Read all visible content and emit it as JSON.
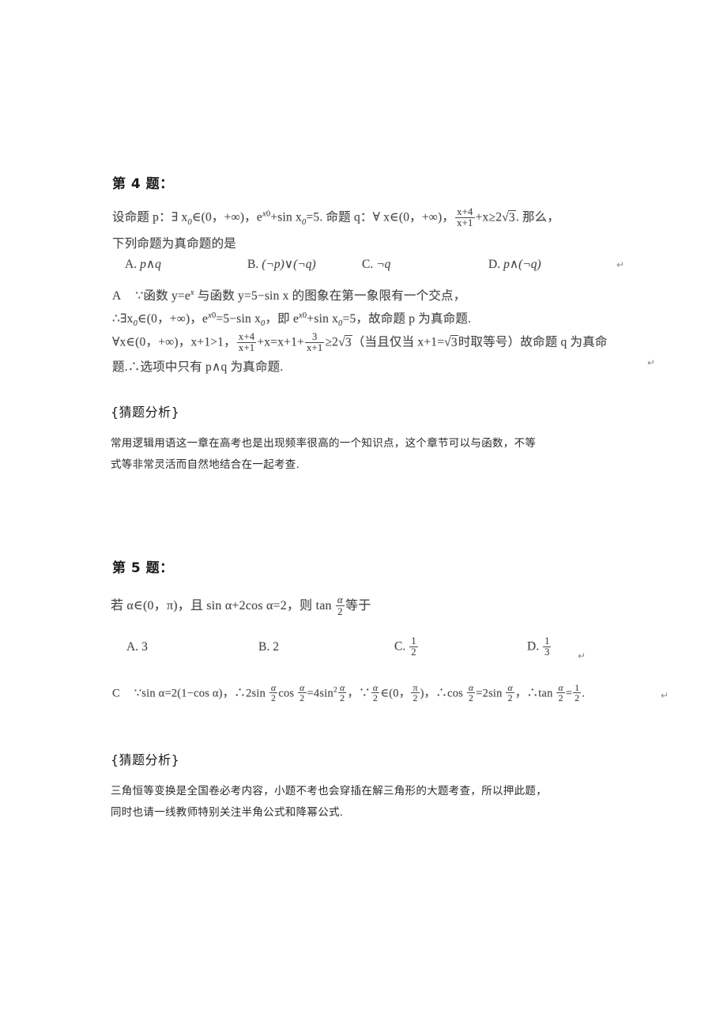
{
  "document": {
    "background_color": "#ffffff",
    "text_color": "#231f20"
  },
  "problems": [
    {
      "id": "q4",
      "heading": "第 4 题：",
      "statement_line1_prefix": "设命题 p：∃ x",
      "statement_line1_a": "∈(0，+∞)，e",
      "statement_line1_b": "+sin x",
      "statement_line1_c": "=5. 命题 q：∀ x∈(0，+∞)，",
      "statement_fraction_num": "x+4",
      "statement_fraction_den": "x+1",
      "statement_line1_d": "+x≥2",
      "statement_radicand": "3",
      "statement_line1_e": ". 那么，",
      "statement_line2": "下列命题为真命题的是",
      "options": [
        {
          "letter": "A.",
          "text": "p∧q"
        },
        {
          "letter": "B.",
          "text": "(¬p)∨(¬q)"
        },
        {
          "letter": "C.",
          "text": "¬q"
        },
        {
          "letter": "D.",
          "text": "p∧(¬q)"
        }
      ],
      "answer_letter": "A",
      "solution_line1": "∵函数 y=e",
      "solution_line1_b": " 与函数 y=5−sin x 的图象在第一象限有一个交点，",
      "solution_line2_a": "∴∃x",
      "solution_line2_b": "∈(0，+∞)，e",
      "solution_line2_c": "=5−sin x",
      "solution_line2_d": "，即 e",
      "solution_line2_e": "+sin x",
      "solution_line2_f": "=5，故命题 p 为真命题.",
      "solution_line3_a": "∀x∈(0，+∞)，x+1>1，",
      "solution_line3_b": "+x=x+1+",
      "solution_line3_frac2_num": "3",
      "solution_line3_frac2_den": "x+1",
      "solution_line3_c": "≥2",
      "solution_line3_d": "（当且仅当 x+1=",
      "solution_line3_e": "时取等号）故命题 q 为真命",
      "solution_line4": "题.∴选项中只有 p∧q 为真命题.",
      "analysis_heading": "{猜题分析}",
      "analysis_line1": "常用逻辑用语这一章在高考也是出现频率很高的一个知识点，这个章节可以与函数，不等",
      "analysis_line2": "式等非常灵活而自然地结合在一起考查."
    },
    {
      "id": "q5",
      "heading": "第 5 题：",
      "statement_a": "若 α∈(0，π)，且 sin α+2cos α=2，则 tan ",
      "statement_frac_num": "α",
      "statement_frac_den": "2",
      "statement_b": "等于",
      "options": [
        {
          "letter": "A.",
          "text": "3"
        },
        {
          "letter": "B.",
          "text": "2"
        },
        {
          "letter": "C.",
          "num": "1",
          "den": "2"
        },
        {
          "letter": "D.",
          "num": "1",
          "den": "3"
        }
      ],
      "answer_letter": "C",
      "solution_a": "∵sin α=2(1−cos α)，∴2sin ",
      "solution_b": "cos ",
      "solution_c": "=4sin",
      "solution_sup": "2",
      "solution_d": "，∵",
      "solution_e": "∈(0，",
      "solution_pi_num": "π",
      "solution_pi_den": "2",
      "solution_f": ")，∴cos ",
      "solution_g": "=2sin ",
      "solution_h": "，∴tan ",
      "solution_i": "=",
      "solution_res_num": "1",
      "solution_res_den": "2",
      "solution_j": ".",
      "alpha_num": "α",
      "alpha_den": "2",
      "analysis_heading": "{猜题分析}",
      "analysis_line1": "三角恒等变换是全国卷必考内容，小题不考也会穿插在解三角形的大题考查，所以押此题，",
      "analysis_line2": "同时也请一线教师特别关注半角公式和降幂公式."
    }
  ],
  "paragraph_marks": [
    {
      "name": "return-mark-q4-options",
      "glyph": "↵"
    },
    {
      "name": "return-mark-q4-solution",
      "glyph": "↵"
    },
    {
      "name": "return-mark-q5-options",
      "glyph": "↵"
    },
    {
      "name": "return-mark-q5-solution",
      "glyph": "↵"
    }
  ]
}
